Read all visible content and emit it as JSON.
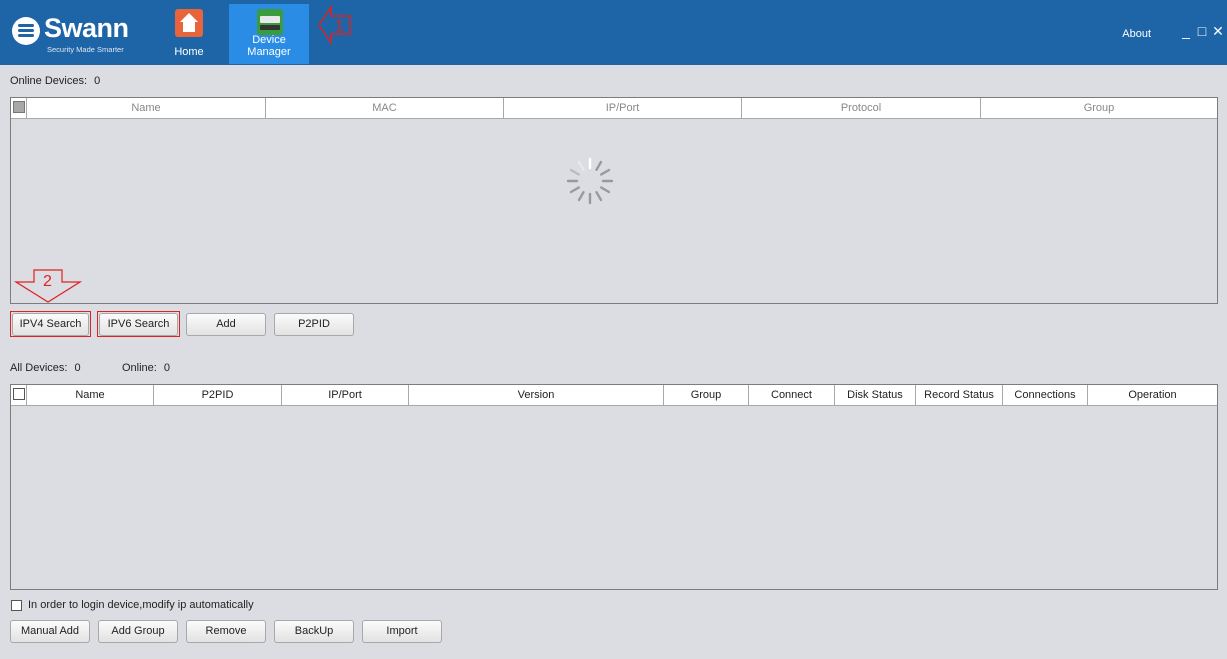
{
  "header": {
    "brand": "Swann",
    "tagline": "Security Made Smarter",
    "nav": [
      {
        "label": "Home",
        "icon": "home-icon"
      },
      {
        "label": "Device Manager",
        "icon": "device-manager-icon",
        "active": true
      }
    ],
    "about": "About",
    "window_controls": {
      "minimize": "_",
      "maximize": "□",
      "close": "✕"
    }
  },
  "annotations": {
    "step1": "1",
    "step2": "2",
    "color": "#dd2222"
  },
  "online": {
    "label": "Online Devices:",
    "count": "0",
    "columns": [
      "Name",
      "MAC",
      "IP/Port",
      "Protocol",
      "Group"
    ],
    "loading": true
  },
  "search_buttons": {
    "ipv4": "IPV4 Search",
    "ipv6": "IPV6 Search",
    "add": "Add",
    "p2pid": "P2PID"
  },
  "all": {
    "label": "All Devices:",
    "count": "0",
    "online_label": "Online:",
    "online_count": "0",
    "columns": [
      "Name",
      "P2PID",
      "IP/Port",
      "Version",
      "Group",
      "Connect",
      "Disk Status",
      "Record Status",
      "Connections",
      "Operation"
    ]
  },
  "auto_ip": {
    "label": "In order to login device,modify ip automatically",
    "checked": false
  },
  "bottom_buttons": {
    "manual_add": "Manual Add",
    "add_group": "Add Group",
    "remove": "Remove",
    "backup": "BackUp",
    "import": "Import"
  },
  "colors": {
    "header": "#1d65a6",
    "active_tab": "#2b8ce6",
    "background": "#dcdde2"
  }
}
